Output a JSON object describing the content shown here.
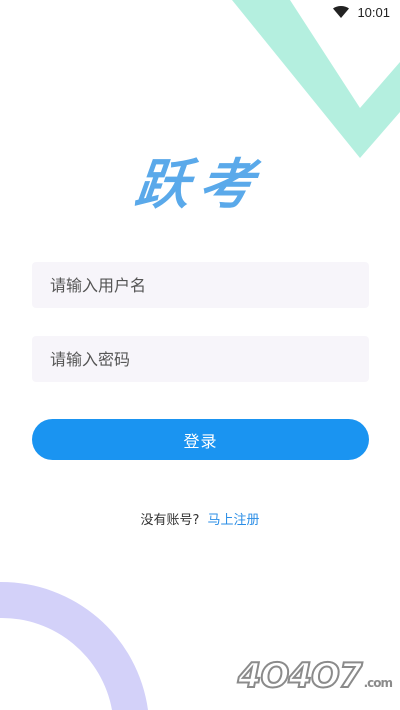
{
  "status_bar": {
    "time": "10:01",
    "wifi_icon": "wifi-icon"
  },
  "colors": {
    "accent": "#1a94f1",
    "logo": "#5aa9ea",
    "link": "#2a8de6",
    "deco_mint": "#b4efdf",
    "deco_lavender": "#d3d1f9",
    "field_bg": "#f7f5fa"
  },
  "logo_text": "跃考",
  "form": {
    "username_placeholder": "请输入用户名",
    "password_placeholder": "请输入密码",
    "login_label": "登录"
  },
  "register": {
    "prompt": "没有账号?",
    "link_label": "马上注册"
  },
  "watermark": {
    "text": "4О4О7",
    "suffix": ".com"
  }
}
